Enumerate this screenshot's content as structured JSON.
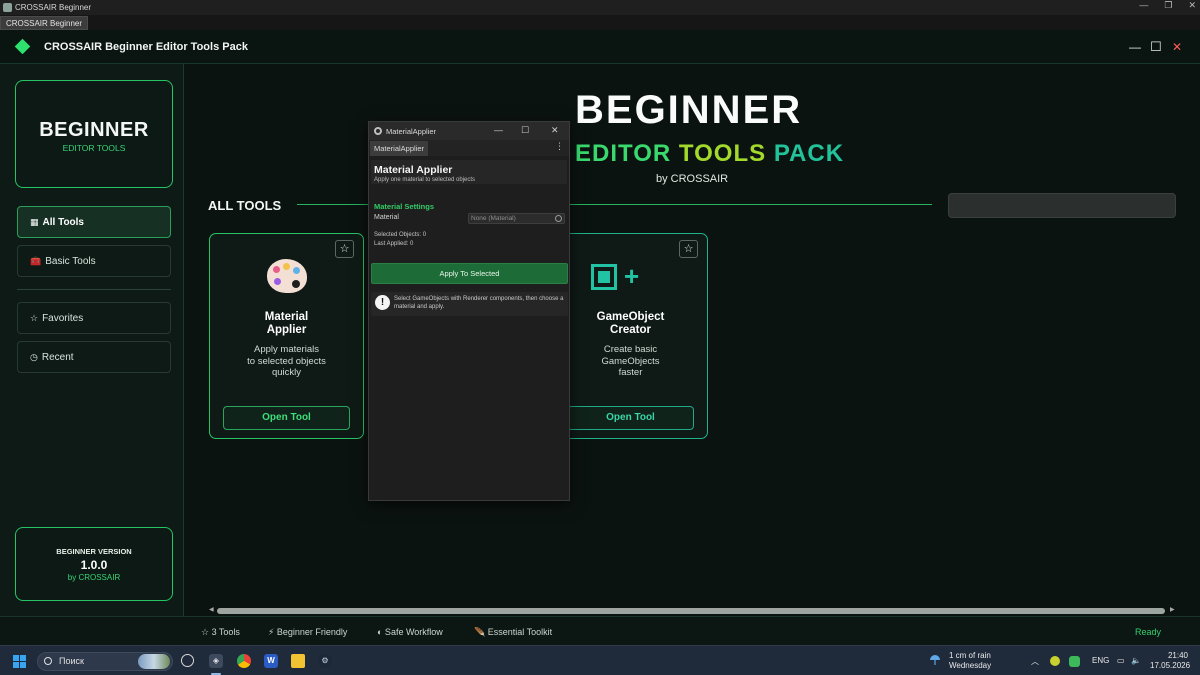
{
  "os_window": {
    "title": "CROSSAIR Beginner",
    "tab": "CROSSAIR Beginner",
    "controls": [
      "—",
      "❐",
      "✕"
    ]
  },
  "header": {
    "title": "CROSSAIR Beginner Editor Tools Pack",
    "controls": [
      "—",
      "☐",
      "✕"
    ]
  },
  "sidebar": {
    "brand": {
      "title": "BEGINNER",
      "subtitle": "EDITOR TOOLS"
    },
    "items": [
      {
        "label": "All Tools",
        "icon": "grid-icon",
        "glyph": "▦",
        "active": true
      },
      {
        "label": "Basic Tools",
        "icon": "toolbox-icon",
        "glyph": "🧰",
        "active": false
      },
      {
        "label": "Favorites",
        "icon": "star-icon",
        "glyph": "☆",
        "active": false
      },
      {
        "label": "Recent",
        "icon": "clock-icon",
        "glyph": "◷",
        "active": false
      }
    ],
    "version": {
      "label": "BEGINNER VERSION",
      "number": "1.0.0",
      "by": "by CROSSAIR"
    }
  },
  "hero": {
    "title": "BEGINNER",
    "subtitle_words": [
      "EDITOR",
      "TOOLS",
      "PACK"
    ],
    "by": "by CROSSAIR"
  },
  "section": {
    "title": "ALL TOOLS",
    "search_placeholder": ""
  },
  "tools": [
    {
      "name": "Material\nApplier",
      "desc": "Apply materials\nto selected objects\nquickly",
      "button": "Open Tool",
      "favorite_glyph": "☆"
    },
    {
      "name": "GameObject\nCreator",
      "desc": "Create basic\nGameObjects\nfaster",
      "button": "Open Tool",
      "favorite_glyph": "☆"
    }
  ],
  "material_window": {
    "title": "MaterialApplier",
    "tab": "MaterialApplier",
    "controls": [
      "—",
      "☐",
      "✕"
    ],
    "heading": "Material Applier",
    "subheading": "Apply one material to selected objects",
    "settings_label": "Material Settings",
    "material_label": "Material",
    "material_value": "None (Material)",
    "selected_objects": "Selected Objects: 0",
    "last_applied": "Last Applied: 0",
    "apply_button": "Apply To Selected",
    "info_text": "Select GameObjects with Renderer components, then choose a material and apply."
  },
  "statusbar": {
    "items": [
      "☆ 3 Tools",
      "⚡ Beginner Friendly",
      "◐ Safe Workflow",
      "🪶 Essential Toolkit"
    ],
    "status": "Ready"
  },
  "taskbar": {
    "search_label": "Поиск",
    "weather_line1": "1 cm of rain",
    "weather_line2": "Wednesday",
    "language": "ENG",
    "time": "21:40",
    "date": "17.05.2026"
  },
  "colors": {
    "accent": "#2ee06e",
    "teal": "#22c3a4",
    "lime": "#a2d92c",
    "apply": "#1d6b36"
  }
}
